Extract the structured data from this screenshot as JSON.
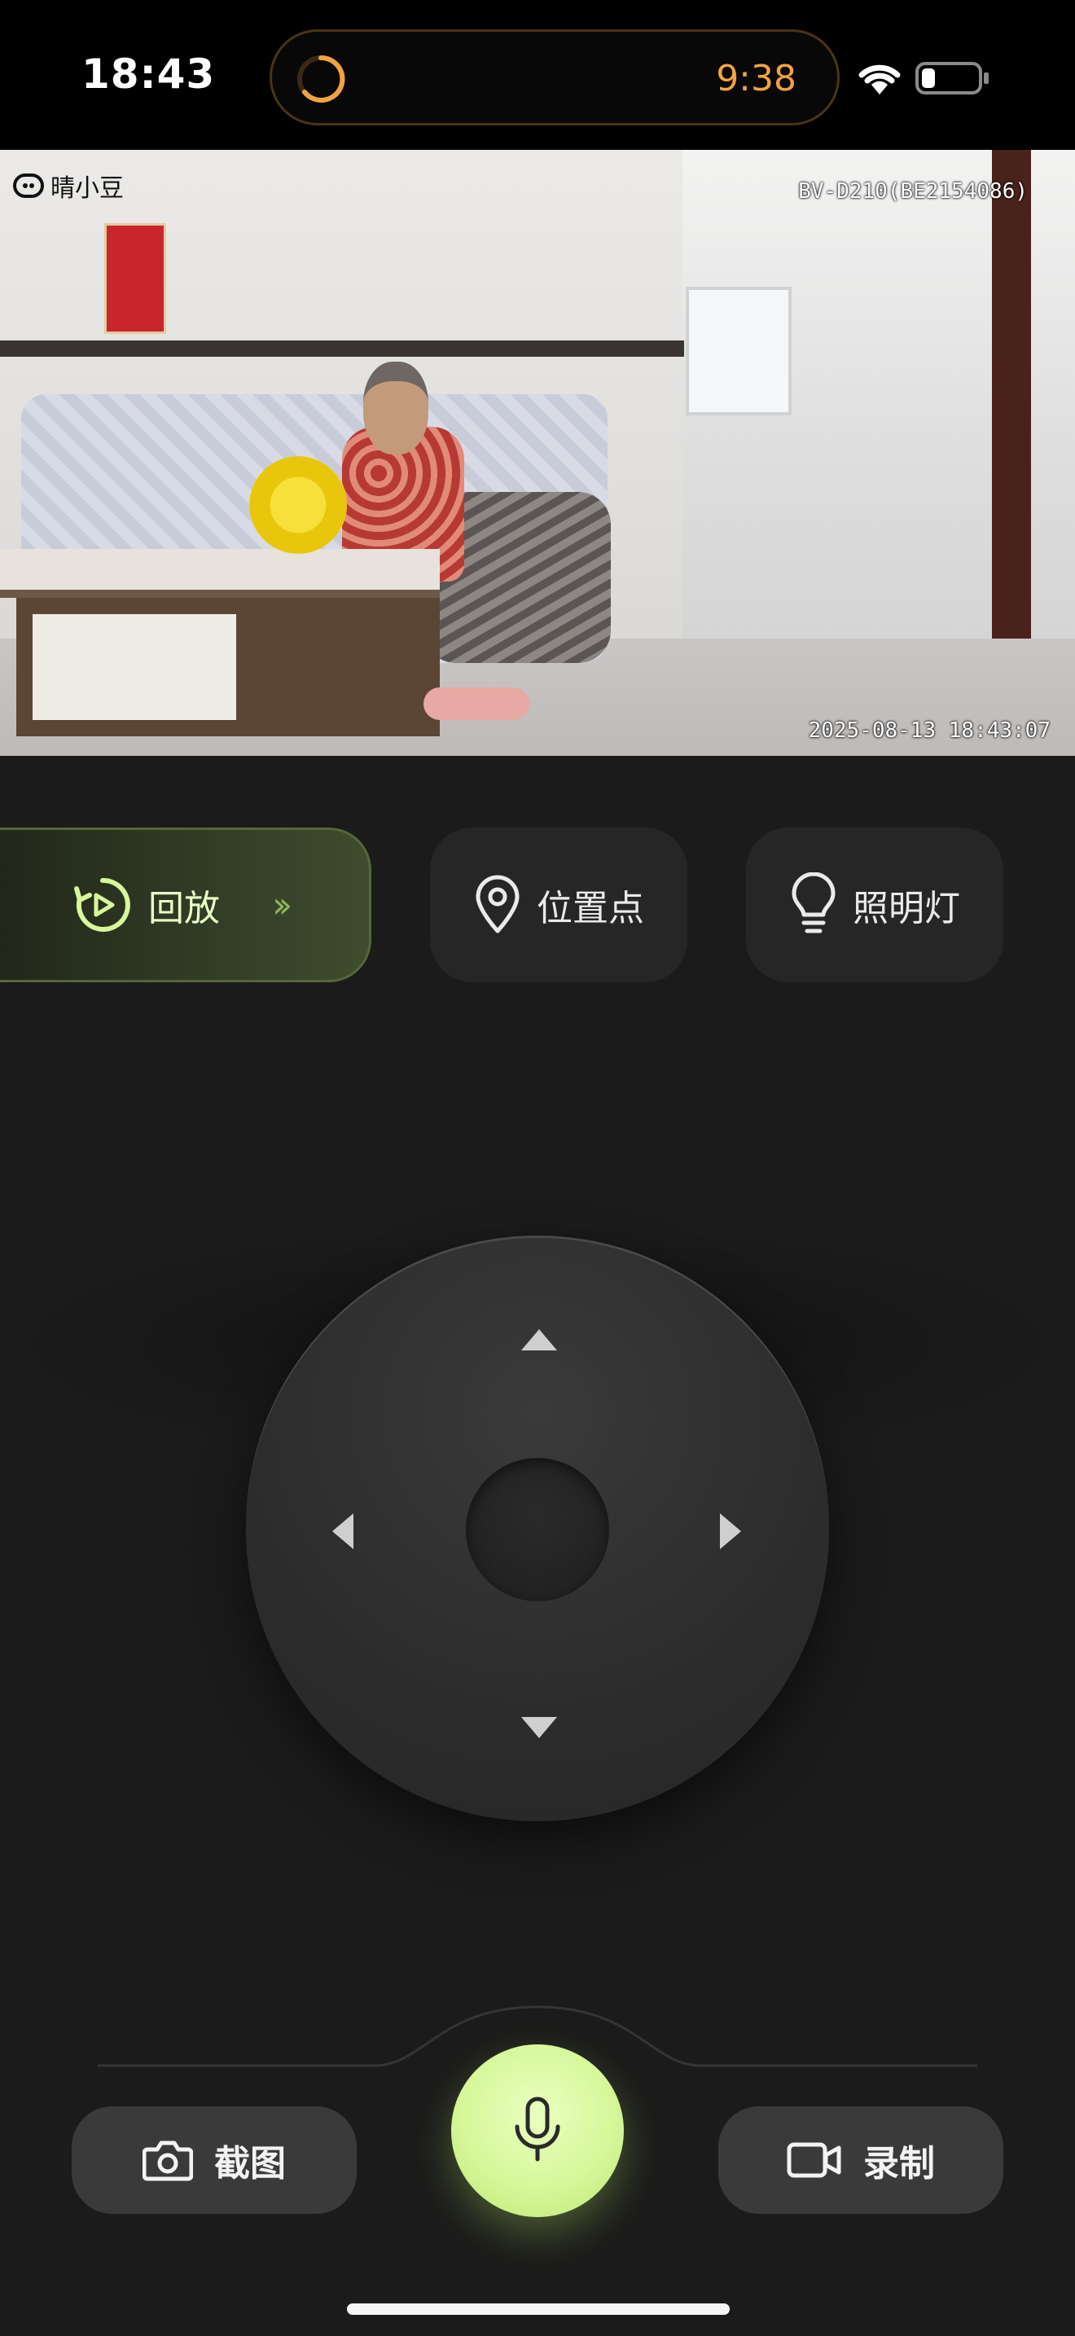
{
  "status_bar": {
    "time": "18:43",
    "activity_timer": "9:38",
    "timer_color": "#f2a341",
    "icons": [
      "wifi-icon",
      "battery-icon"
    ]
  },
  "camera": {
    "brand": "晴小豆",
    "device_id": "BV-D210(BE2154086)",
    "timestamp": "2025-08-13 18:43:07"
  },
  "actions": {
    "playback": {
      "label": "回放",
      "icon": "playback-icon"
    },
    "location": {
      "label": "位置点",
      "icon": "location-pin-icon"
    },
    "light": {
      "label": "照明灯",
      "icon": "lightbulb-icon"
    }
  },
  "joystick": {
    "directions": [
      "up",
      "down",
      "left",
      "right"
    ]
  },
  "bottom": {
    "screenshot": {
      "label": "截图",
      "icon": "camera-icon"
    },
    "record": {
      "label": "录制",
      "icon": "video-camera-icon"
    },
    "mic": {
      "icon": "microphone-icon"
    }
  },
  "colors": {
    "background": "#1b1b1b",
    "accent_green": "#d7f79a",
    "button_gray": "#3a3a3a"
  }
}
